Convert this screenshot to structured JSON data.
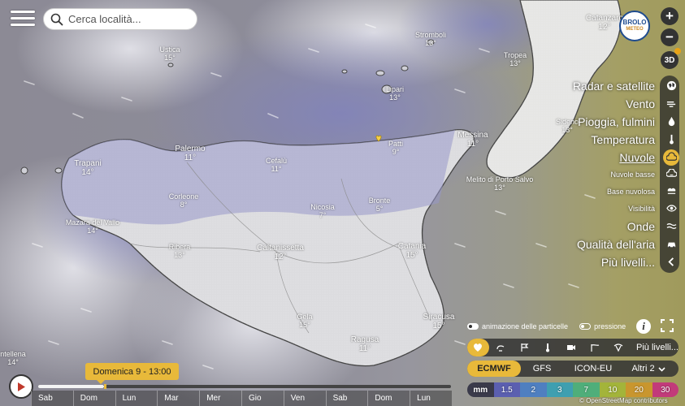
{
  "search": {
    "placeholder": "Cerca località..."
  },
  "brand": {
    "line1": "BROLO",
    "line2": "METEO"
  },
  "map_controls": {
    "zoom_in": "+",
    "zoom_out": "−",
    "view3d": "3D"
  },
  "cities": [
    {
      "name": "Ustica",
      "temp": "15°"
    },
    {
      "name": "Stromboli",
      "temp": "13°"
    },
    {
      "name": "Catanzaro",
      "temp": "12°"
    },
    {
      "name": "Tropea",
      "temp": "13°"
    },
    {
      "name": "Lipari",
      "temp": "13°"
    },
    {
      "name": "Sideno",
      "temp": "13°"
    },
    {
      "name": "Messina",
      "temp": "11°"
    },
    {
      "name": "Patti",
      "temp": "9°"
    },
    {
      "name": "Palermo",
      "temp": "11°"
    },
    {
      "name": "Trapani",
      "temp": "14°"
    },
    {
      "name": "Cefalù",
      "temp": "11°"
    },
    {
      "name": "Melito di Porto Salvo",
      "temp": "13°"
    },
    {
      "name": "Corleone",
      "temp": "8°"
    },
    {
      "name": "Nicosia",
      "temp": "7°"
    },
    {
      "name": "Bronte",
      "temp": "5°"
    },
    {
      "name": "Mazara del Vallo",
      "temp": "14°"
    },
    {
      "name": "Ribera",
      "temp": "13°"
    },
    {
      "name": "Caltanissetta",
      "temp": "12°"
    },
    {
      "name": "Catania",
      "temp": "15°"
    },
    {
      "name": "Gela",
      "temp": "15°"
    },
    {
      "name": "Siracusa",
      "temp": "15°"
    },
    {
      "name": "Ragusa",
      "temp": "11°"
    },
    {
      "name": "ntellena",
      "temp": "14°"
    }
  ],
  "layers": [
    {
      "label": "Radar e satellite",
      "icon": "radar-icon"
    },
    {
      "label": "Vento",
      "icon": "wind-icon"
    },
    {
      "label": "Pioggia, fulmini",
      "icon": "rain-drop-icon"
    },
    {
      "label": "Temperatura",
      "icon": "thermometer-icon"
    },
    {
      "label": "Nuvole",
      "icon": "cloud-icon"
    },
    {
      "label": "Nuvole basse",
      "icon": "low-cloud-icon"
    },
    {
      "label": "Base nuvolosa",
      "icon": "cloud-base-icon"
    },
    {
      "label": "Visibilità",
      "icon": "eye-icon"
    },
    {
      "label": "Onde",
      "icon": "waves-icon"
    },
    {
      "label": "Qualità dell'aria",
      "icon": "car-icon"
    },
    {
      "label": "Più livelli...",
      "icon": "chevron-left-icon"
    }
  ],
  "selected_layer": "Nuvole",
  "toggles": {
    "particles": "animazione delle particelle",
    "pressure": "pressione"
  },
  "viewbar": {
    "more": "Più livelli..."
  },
  "models": [
    {
      "label": "ECMWF",
      "selected": true
    },
    {
      "label": "GFS",
      "selected": false
    },
    {
      "label": "ICON-EU",
      "selected": false
    },
    {
      "label": "Altri 2",
      "selected": false
    }
  ],
  "legend": {
    "unit": "mm",
    "stops": [
      {
        "value": "1.5",
        "color": "#5b5fb0"
      },
      {
        "value": "2",
        "color": "#4f7fc0"
      },
      {
        "value": "3",
        "color": "#3f9fb0"
      },
      {
        "value": "7",
        "color": "#4fae7a"
      },
      {
        "value": "10",
        "color": "#a3b43a"
      },
      {
        "value": "20",
        "color": "#c9962e"
      },
      {
        "value": "30",
        "color": "#c23a7a"
      }
    ]
  },
  "attribution": "© OpenStreetMap contributors",
  "timeline": {
    "current": "Domenica 9 - 13:00",
    "progress_fraction": 0.16,
    "days": [
      "Sab",
      "Dom",
      "Lun",
      "Mar",
      "Mer",
      "Gio",
      "Ven",
      "Sab",
      "Dom",
      "Lun"
    ]
  },
  "colors": {
    "accent": "#e8b93a",
    "panel": "#333333"
  }
}
